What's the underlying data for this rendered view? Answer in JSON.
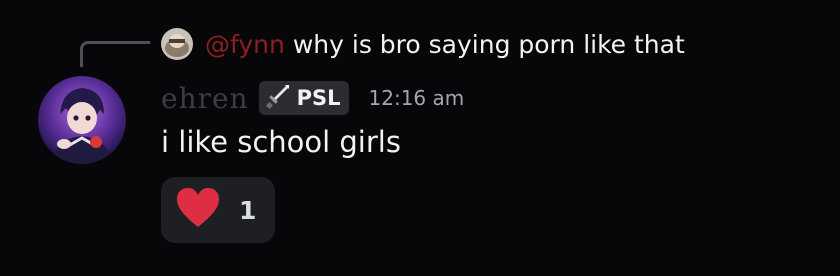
{
  "reply": {
    "mention": "@fynn",
    "text": "why is bro saying porn like that",
    "mention_color": "#8c1f1f"
  },
  "message": {
    "username": "ehren",
    "username_color": "#3c3d44",
    "tag": {
      "icon": "sword-icon",
      "label": "PSL"
    },
    "timestamp": "12:16 am",
    "content": "i like school girls"
  },
  "reaction": {
    "emoji": "heart-icon",
    "count": "1",
    "emoji_color": "#dd2e44"
  }
}
